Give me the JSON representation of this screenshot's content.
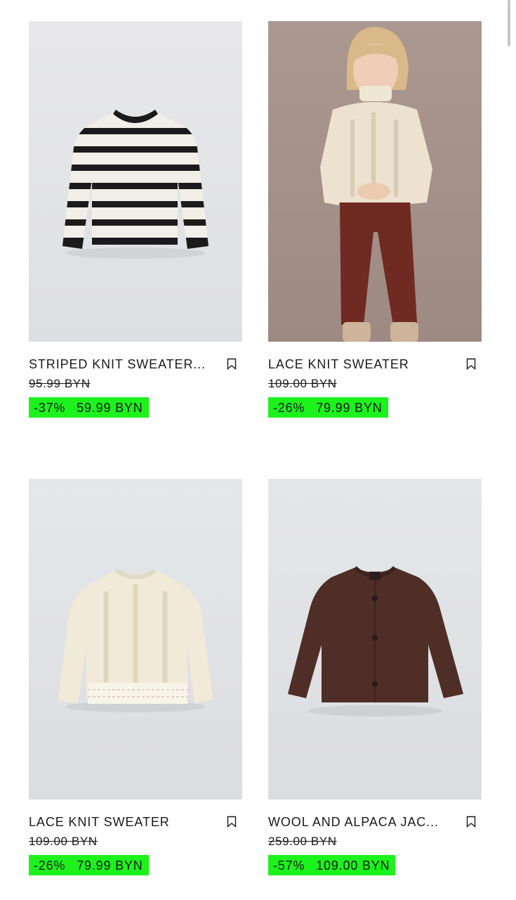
{
  "products": [
    {
      "name": "STRIPED KNIT SWEATER...",
      "old_price": "95.99 BYN",
      "discount": "-37%",
      "price": "59.99 BYN",
      "image": "striped-sweater-photo"
    },
    {
      "name": "LACE KNIT SWEATER",
      "old_price": "109.00 BYN",
      "discount": "-26%",
      "price": "79.99 BYN",
      "image": "child-model-photo"
    },
    {
      "name": "LACE KNIT SWEATER",
      "old_price": "109.00 BYN",
      "discount": "-26%",
      "price": "79.99 BYN",
      "image": "cream-lace-sweater-photo"
    },
    {
      "name": "WOOL AND ALPACA JAC...",
      "old_price": "259.00 BYN",
      "discount": "-57%",
      "price": "109.00 BYN",
      "image": "brown-jacket-photo"
    }
  ],
  "colors": {
    "sale_badge": "#1cf21c",
    "text": "#1a1a1a",
    "photo_bg_light": "#e6e7e9",
    "photo_bg_model": "#a39088"
  },
  "icons": {
    "bookmark": "bookmark-icon"
  }
}
